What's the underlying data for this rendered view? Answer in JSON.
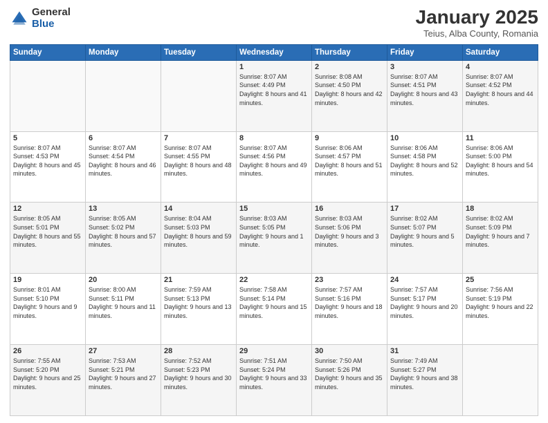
{
  "logo": {
    "general": "General",
    "blue": "Blue"
  },
  "header": {
    "month": "January 2025",
    "location": "Teius, Alba County, Romania"
  },
  "days_of_week": [
    "Sunday",
    "Monday",
    "Tuesday",
    "Wednesday",
    "Thursday",
    "Friday",
    "Saturday"
  ],
  "weeks": [
    [
      {
        "day": "",
        "info": ""
      },
      {
        "day": "",
        "info": ""
      },
      {
        "day": "",
        "info": ""
      },
      {
        "day": "1",
        "info": "Sunrise: 8:07 AM\nSunset: 4:49 PM\nDaylight: 8 hours and 41 minutes."
      },
      {
        "day": "2",
        "info": "Sunrise: 8:08 AM\nSunset: 4:50 PM\nDaylight: 8 hours and 42 minutes."
      },
      {
        "day": "3",
        "info": "Sunrise: 8:07 AM\nSunset: 4:51 PM\nDaylight: 8 hours and 43 minutes."
      },
      {
        "day": "4",
        "info": "Sunrise: 8:07 AM\nSunset: 4:52 PM\nDaylight: 8 hours and 44 minutes."
      }
    ],
    [
      {
        "day": "5",
        "info": "Sunrise: 8:07 AM\nSunset: 4:53 PM\nDaylight: 8 hours and 45 minutes."
      },
      {
        "day": "6",
        "info": "Sunrise: 8:07 AM\nSunset: 4:54 PM\nDaylight: 8 hours and 46 minutes."
      },
      {
        "day": "7",
        "info": "Sunrise: 8:07 AM\nSunset: 4:55 PM\nDaylight: 8 hours and 48 minutes."
      },
      {
        "day": "8",
        "info": "Sunrise: 8:07 AM\nSunset: 4:56 PM\nDaylight: 8 hours and 49 minutes."
      },
      {
        "day": "9",
        "info": "Sunrise: 8:06 AM\nSunset: 4:57 PM\nDaylight: 8 hours and 51 minutes."
      },
      {
        "day": "10",
        "info": "Sunrise: 8:06 AM\nSunset: 4:58 PM\nDaylight: 8 hours and 52 minutes."
      },
      {
        "day": "11",
        "info": "Sunrise: 8:06 AM\nSunset: 5:00 PM\nDaylight: 8 hours and 54 minutes."
      }
    ],
    [
      {
        "day": "12",
        "info": "Sunrise: 8:05 AM\nSunset: 5:01 PM\nDaylight: 8 hours and 55 minutes."
      },
      {
        "day": "13",
        "info": "Sunrise: 8:05 AM\nSunset: 5:02 PM\nDaylight: 8 hours and 57 minutes."
      },
      {
        "day": "14",
        "info": "Sunrise: 8:04 AM\nSunset: 5:03 PM\nDaylight: 8 hours and 59 minutes."
      },
      {
        "day": "15",
        "info": "Sunrise: 8:03 AM\nSunset: 5:05 PM\nDaylight: 9 hours and 1 minute."
      },
      {
        "day": "16",
        "info": "Sunrise: 8:03 AM\nSunset: 5:06 PM\nDaylight: 9 hours and 3 minutes."
      },
      {
        "day": "17",
        "info": "Sunrise: 8:02 AM\nSunset: 5:07 PM\nDaylight: 9 hours and 5 minutes."
      },
      {
        "day": "18",
        "info": "Sunrise: 8:02 AM\nSunset: 5:09 PM\nDaylight: 9 hours and 7 minutes."
      }
    ],
    [
      {
        "day": "19",
        "info": "Sunrise: 8:01 AM\nSunset: 5:10 PM\nDaylight: 9 hours and 9 minutes."
      },
      {
        "day": "20",
        "info": "Sunrise: 8:00 AM\nSunset: 5:11 PM\nDaylight: 9 hours and 11 minutes."
      },
      {
        "day": "21",
        "info": "Sunrise: 7:59 AM\nSunset: 5:13 PM\nDaylight: 9 hours and 13 minutes."
      },
      {
        "day": "22",
        "info": "Sunrise: 7:58 AM\nSunset: 5:14 PM\nDaylight: 9 hours and 15 minutes."
      },
      {
        "day": "23",
        "info": "Sunrise: 7:57 AM\nSunset: 5:16 PM\nDaylight: 9 hours and 18 minutes."
      },
      {
        "day": "24",
        "info": "Sunrise: 7:57 AM\nSunset: 5:17 PM\nDaylight: 9 hours and 20 minutes."
      },
      {
        "day": "25",
        "info": "Sunrise: 7:56 AM\nSunset: 5:19 PM\nDaylight: 9 hours and 22 minutes."
      }
    ],
    [
      {
        "day": "26",
        "info": "Sunrise: 7:55 AM\nSunset: 5:20 PM\nDaylight: 9 hours and 25 minutes."
      },
      {
        "day": "27",
        "info": "Sunrise: 7:53 AM\nSunset: 5:21 PM\nDaylight: 9 hours and 27 minutes."
      },
      {
        "day": "28",
        "info": "Sunrise: 7:52 AM\nSunset: 5:23 PM\nDaylight: 9 hours and 30 minutes."
      },
      {
        "day": "29",
        "info": "Sunrise: 7:51 AM\nSunset: 5:24 PM\nDaylight: 9 hours and 33 minutes."
      },
      {
        "day": "30",
        "info": "Sunrise: 7:50 AM\nSunset: 5:26 PM\nDaylight: 9 hours and 35 minutes."
      },
      {
        "day": "31",
        "info": "Sunrise: 7:49 AM\nSunset: 5:27 PM\nDaylight: 9 hours and 38 minutes."
      },
      {
        "day": "",
        "info": ""
      }
    ]
  ]
}
